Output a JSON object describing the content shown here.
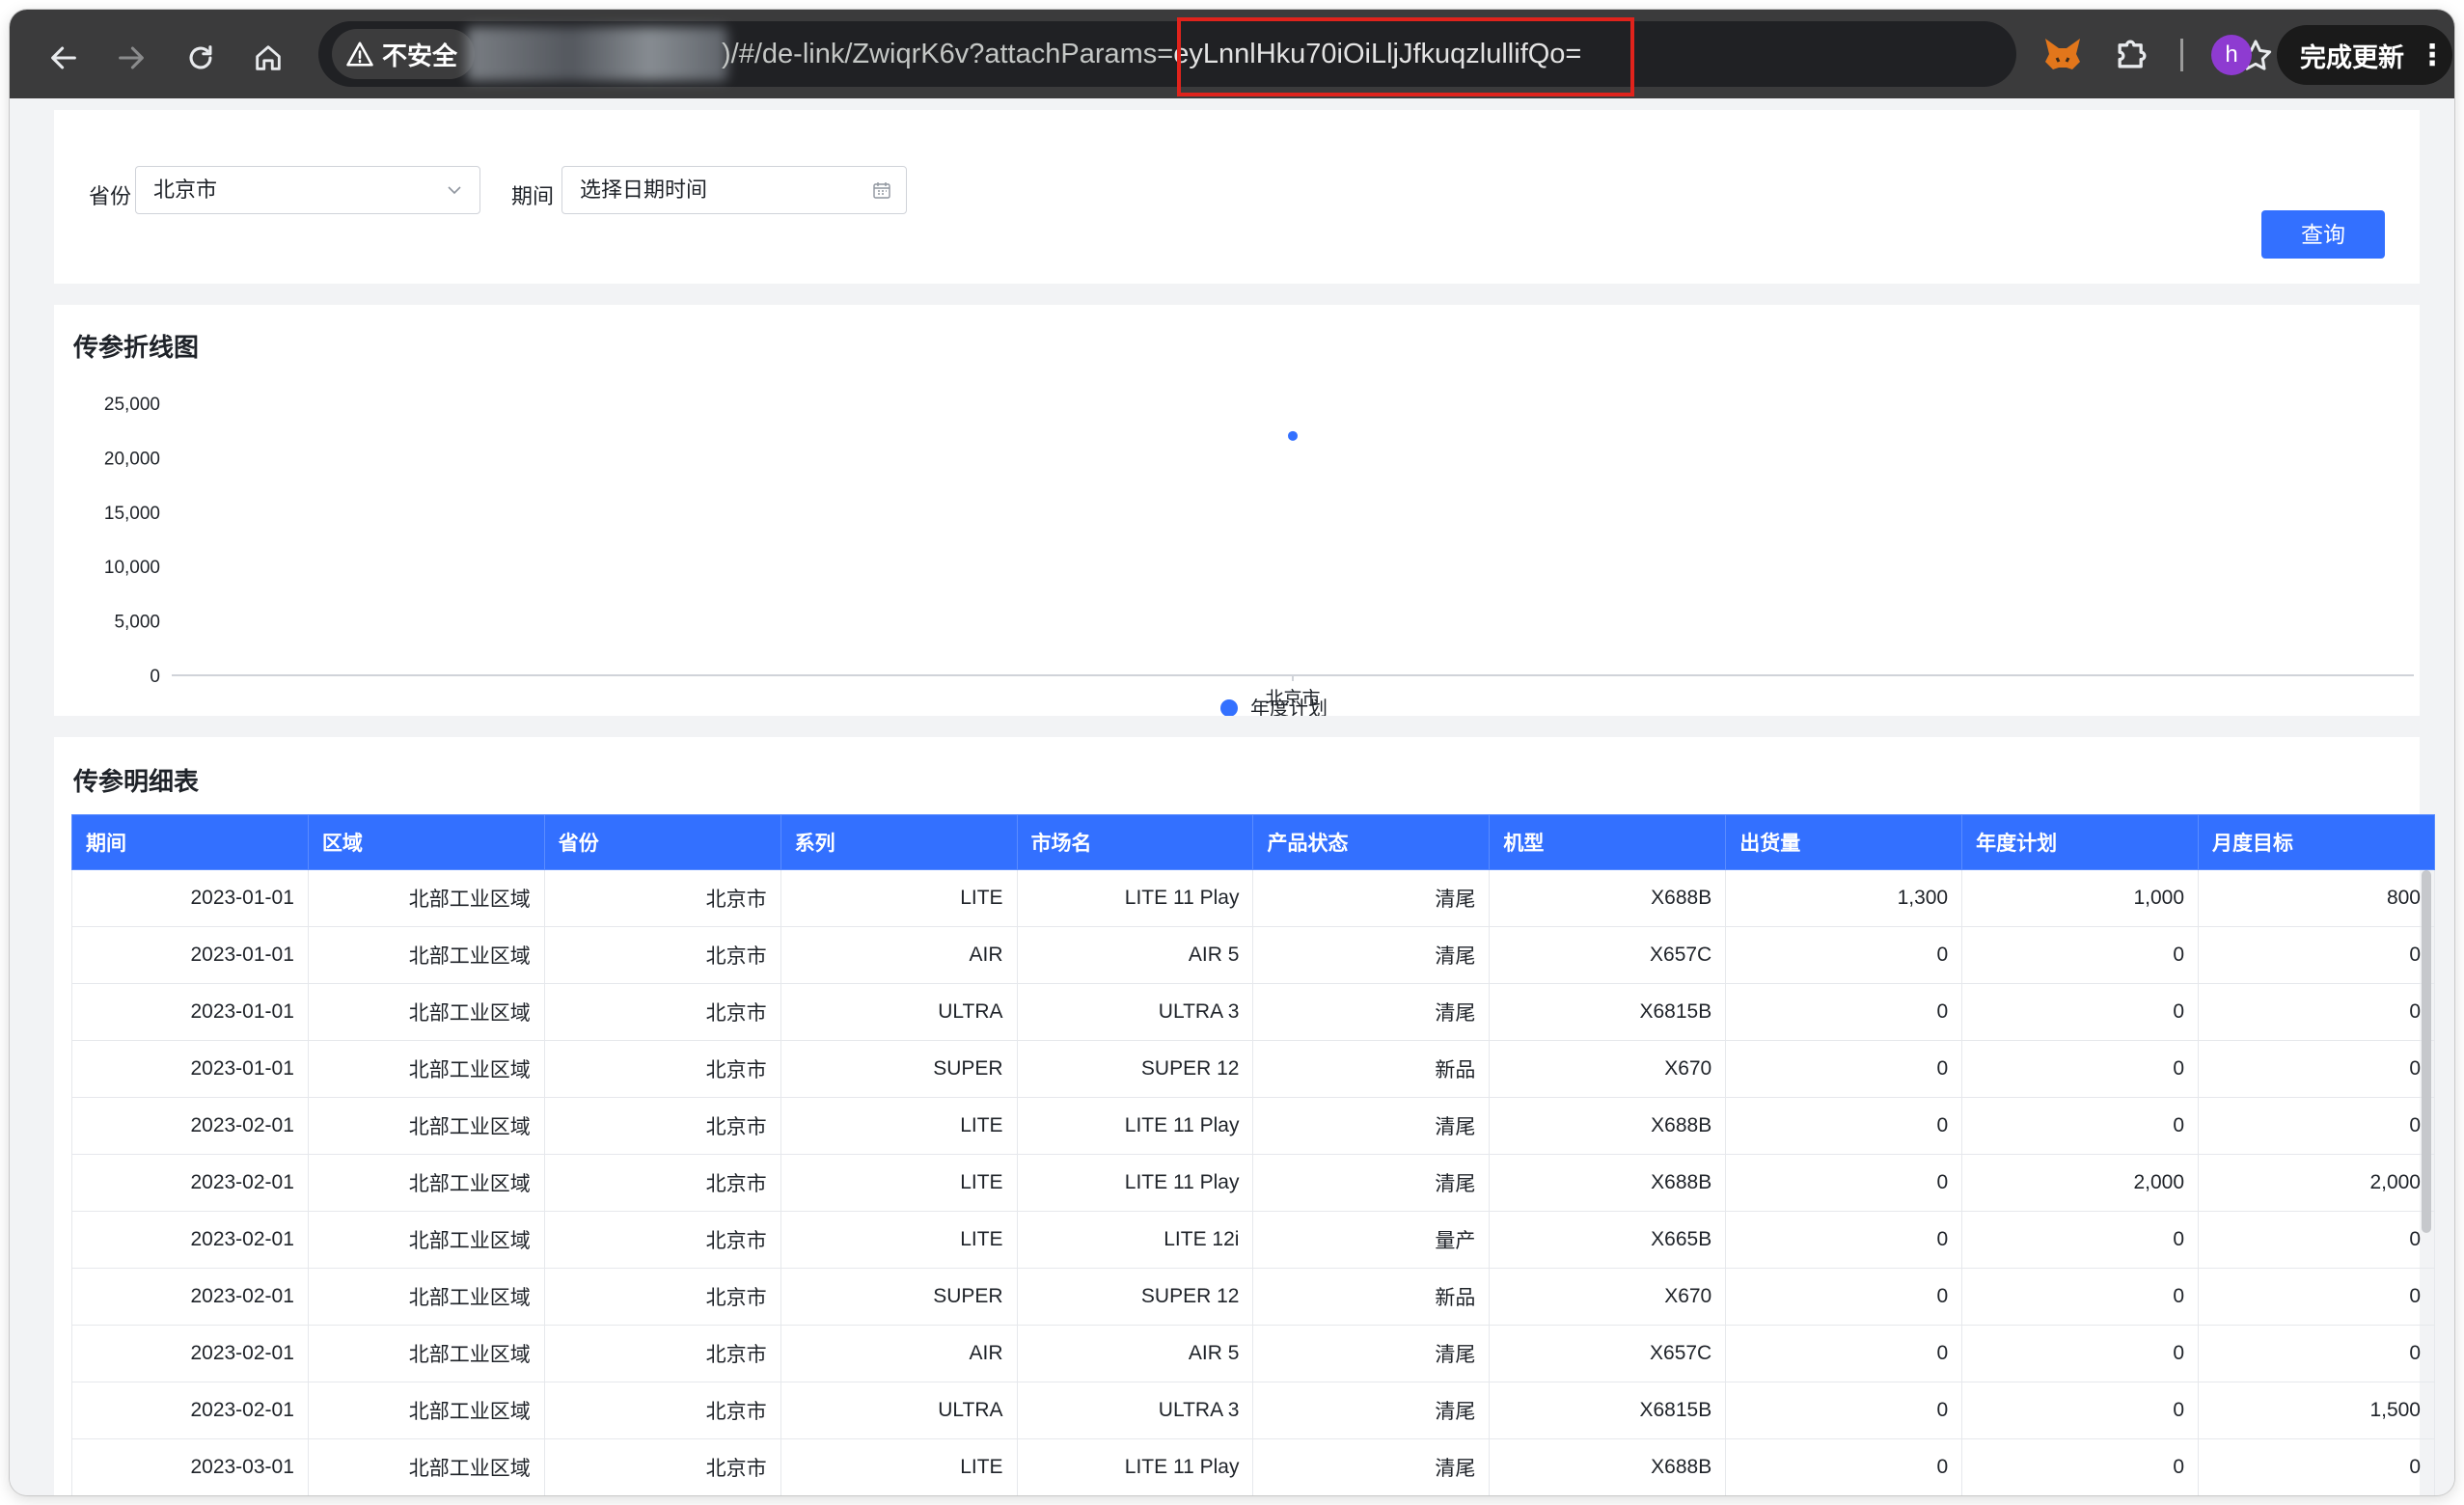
{
  "browser": {
    "security_label": "不安全",
    "url_visible": ")/#/de-link/ZwiqrK6v?attachParams=",
    "url_highlight": "eyLnnlHku70iOiLljJfkuqzlullifQo=",
    "avatar_letter": "h",
    "update_label": "完成更新",
    "update_menu": "⋮"
  },
  "filters": {
    "province_label": "省份",
    "province_value": "北京市",
    "period_label": "期间",
    "period_placeholder": "选择日期时间",
    "query_label": "查询"
  },
  "chart_section": {
    "title": "传参折线图"
  },
  "chart_data": {
    "type": "line",
    "title": "传参折线图",
    "categories": [
      "北京市"
    ],
    "series": [
      {
        "name": "年度计划",
        "values": [
          22000
        ],
        "color": "#3370ff"
      }
    ],
    "yticks": [
      "25,000",
      "20,000",
      "15,000",
      "10,000",
      "5,000",
      "0"
    ],
    "ylim": [
      0,
      25000
    ],
    "legend_position": "bottom-center"
  },
  "table_section": {
    "title": "传参明细表",
    "columns": [
      "期间",
      "区域",
      "省份",
      "系列",
      "市场名",
      "产品状态",
      "机型",
      "出货量",
      "年度计划",
      "月度目标"
    ],
    "rows": [
      [
        "2023-01-01",
        "北部工业区域",
        "北京市",
        "LITE",
        "LITE 11 Play",
        "清尾",
        "X688B",
        "1,300",
        "1,000",
        "800"
      ],
      [
        "2023-01-01",
        "北部工业区域",
        "北京市",
        "AIR",
        "AIR 5",
        "清尾",
        "X657C",
        "0",
        "0",
        "0"
      ],
      [
        "2023-01-01",
        "北部工业区域",
        "北京市",
        "ULTRA",
        "ULTRA 3",
        "清尾",
        "X6815B",
        "0",
        "0",
        "0"
      ],
      [
        "2023-01-01",
        "北部工业区域",
        "北京市",
        "SUPER",
        "SUPER 12",
        "新品",
        "X670",
        "0",
        "0",
        "0"
      ],
      [
        "2023-02-01",
        "北部工业区域",
        "北京市",
        "LITE",
        "LITE 11 Play",
        "清尾",
        "X688B",
        "0",
        "0",
        "0"
      ],
      [
        "2023-02-01",
        "北部工业区域",
        "北京市",
        "LITE",
        "LITE 11 Play",
        "清尾",
        "X688B",
        "0",
        "2,000",
        "2,000"
      ],
      [
        "2023-02-01",
        "北部工业区域",
        "北京市",
        "LITE",
        "LITE 12i",
        "量产",
        "X665B",
        "0",
        "0",
        "0"
      ],
      [
        "2023-02-01",
        "北部工业区域",
        "北京市",
        "SUPER",
        "SUPER 12",
        "新品",
        "X670",
        "0",
        "0",
        "0"
      ],
      [
        "2023-02-01",
        "北部工业区域",
        "北京市",
        "AIR",
        "AIR 5",
        "清尾",
        "X657C",
        "0",
        "0",
        "0"
      ],
      [
        "2023-02-01",
        "北部工业区域",
        "北京市",
        "ULTRA",
        "ULTRA 3",
        "清尾",
        "X6815B",
        "0",
        "0",
        "1,500"
      ],
      [
        "2023-03-01",
        "北部工业区域",
        "北京市",
        "LITE",
        "LITE 11 Play",
        "清尾",
        "X688B",
        "0",
        "0",
        "0"
      ],
      [
        "",
        "",
        "",
        "",
        "",
        "",
        "",
        "",
        "",
        ""
      ]
    ]
  }
}
